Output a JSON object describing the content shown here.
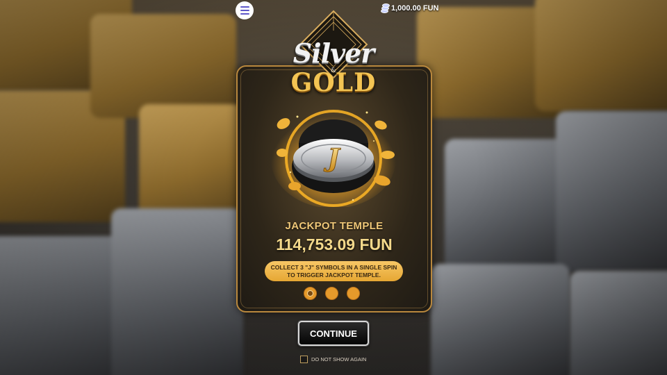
{
  "header": {
    "balance": "1,000.00 FUN",
    "menu_icon": "hamburger-icon",
    "currency_icon": "coins-icon"
  },
  "logo": {
    "silver": "Silver",
    "amp": "&",
    "gold": "GOLD"
  },
  "feature": {
    "symbol": "J",
    "title": "JACKPOT TEMPLE",
    "amount": "114,753.09 FUN",
    "info_line1": "COLLECT 3 \"J\" SYMBOLS IN A SINGLE SPIN",
    "info_line2": "TO TRIGGER JACKPOT TEMPLE."
  },
  "pagination": {
    "total": 3,
    "active": 1
  },
  "actions": {
    "continue_label": "CONTINUE",
    "dont_show_label": "DO NOT SHOW AGAIN",
    "dont_show_checked": false
  },
  "colors": {
    "accent_gold": "#e6a733",
    "card_border": "#b9883d",
    "menu_icon": "#5e57c9"
  }
}
